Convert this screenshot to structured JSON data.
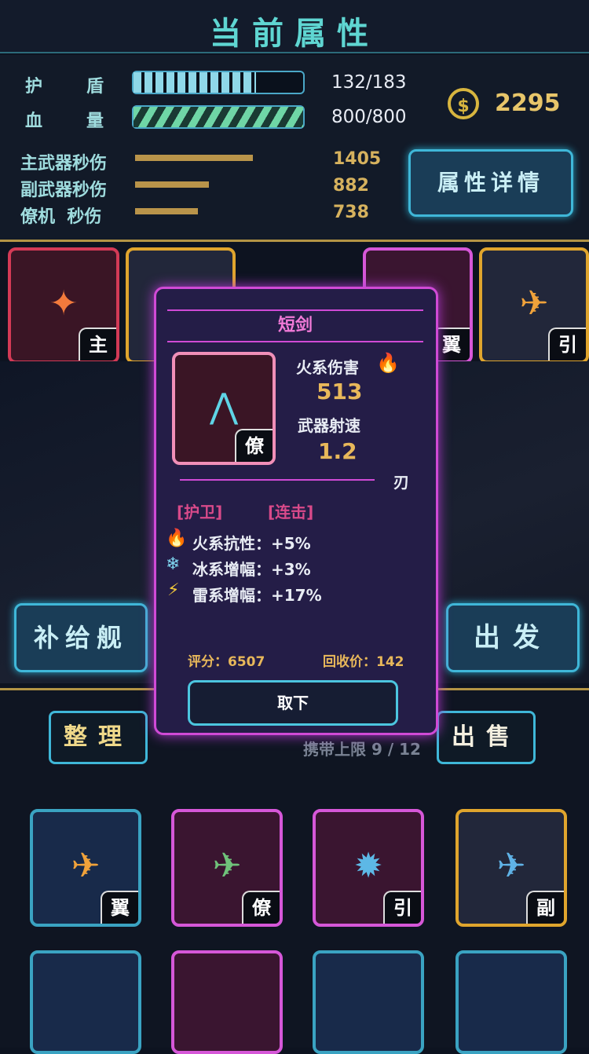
{
  "header": {
    "title": "当前属性"
  },
  "stats": {
    "shield": {
      "label_a": "护",
      "label_b": "盾",
      "value": "132/183",
      "fraction": 0.72
    },
    "hp": {
      "label_a": "血",
      "label_b": "量",
      "value": "800/800",
      "fraction": 1.0
    },
    "weapons": [
      {
        "label": "主武器秒伤",
        "value": "1405"
      },
      {
        "label": "副武器秒伤",
        "value": "882"
      },
      {
        "label": "僚机  秒伤",
        "value": "738"
      }
    ],
    "coins": "2295",
    "details_button": "属性详情"
  },
  "equipped": {
    "tags": [
      "主",
      "翼",
      "引"
    ]
  },
  "popup": {
    "title": "短剑",
    "item_tag": "僚",
    "fire_damage_label": "火系伤害",
    "fire_damage_value": "513",
    "fire_rate_label": "武器射速",
    "fire_rate_value": "1.2",
    "type_label": "刃",
    "traits": [
      "[护卫]",
      "[连击]"
    ],
    "attributes": [
      {
        "icon": "fire-icon",
        "text": "火系抗性：+5%"
      },
      {
        "icon": "snowflake-icon",
        "text": "冰系增幅：+3%"
      },
      {
        "icon": "lightning-icon",
        "text": "雷系增幅：+17%"
      }
    ],
    "score": "评分：6507",
    "recycle": "回收价：142",
    "remove_button": "取下"
  },
  "actions": {
    "supply": "补给舰",
    "depart": "出发",
    "organize": "整理",
    "sell": "出售",
    "capacity": "携带上限 9 / 12"
  },
  "inventory": {
    "tags": [
      "翼",
      "僚",
      "引",
      "副"
    ]
  }
}
